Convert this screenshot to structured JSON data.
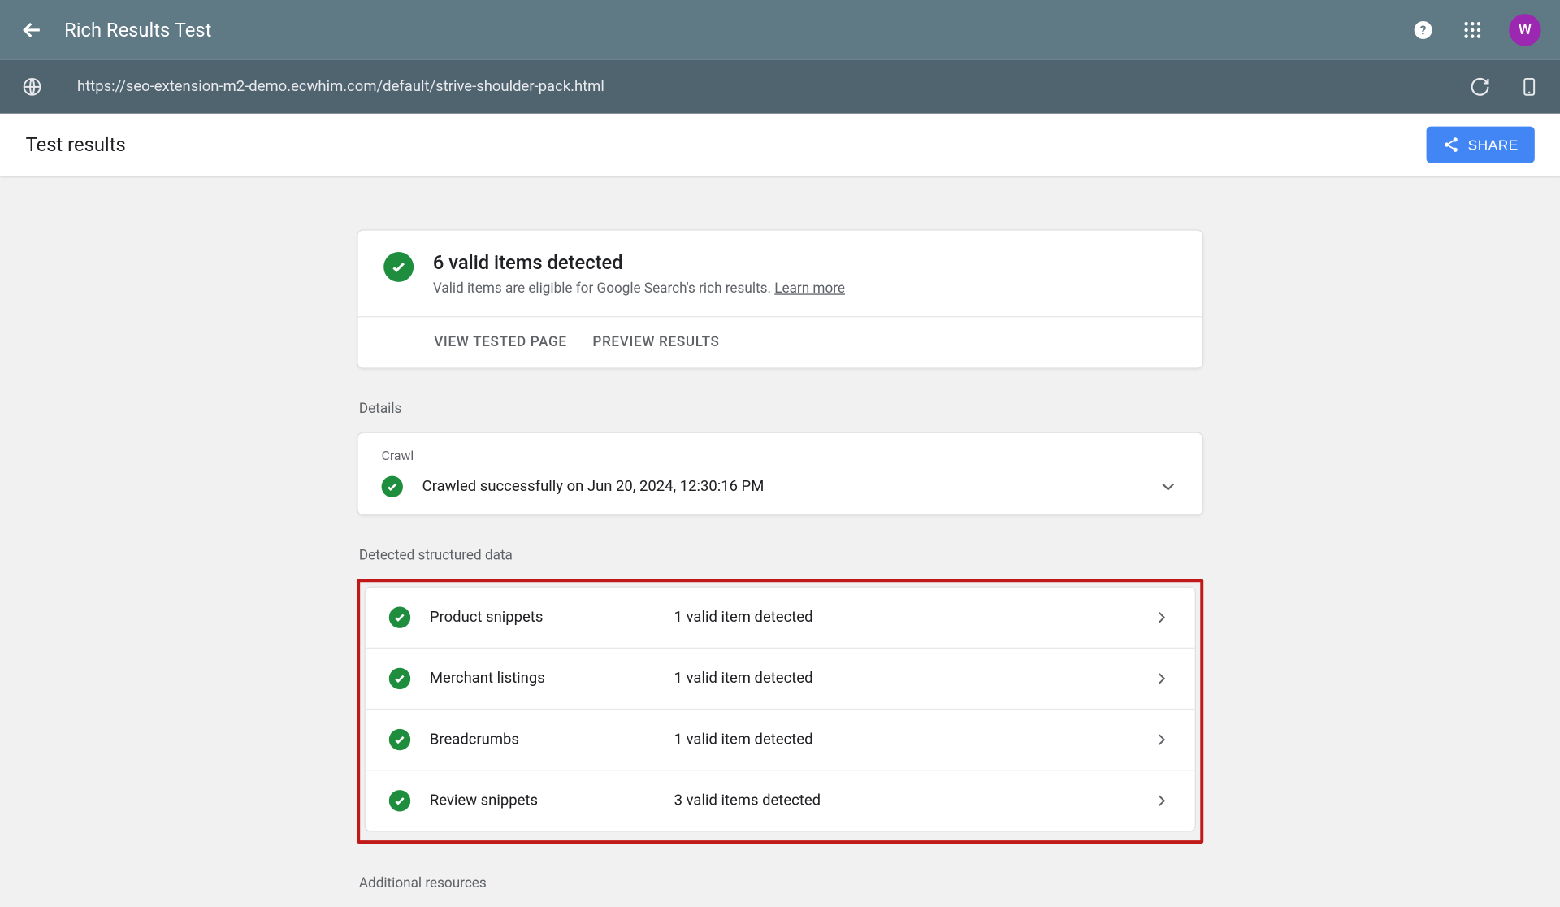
{
  "header": {
    "title": "Rich Results Test",
    "avatar_initial": "W"
  },
  "url_bar": {
    "url": "https://seo-extension-m2-demo.ecwhim.com/default/strive-shoulder-pack.html"
  },
  "subheader": {
    "title": "Test results",
    "share_label": "SHARE"
  },
  "summary": {
    "title": "6 valid items detected",
    "subtitle_prefix": "Valid items are eligible for Google Search's rich results. ",
    "learn_more": "Learn more",
    "view_tested": "VIEW TESTED PAGE",
    "preview_results": "PREVIEW RESULTS"
  },
  "sections": {
    "details_label": "Details",
    "crawl_label": "Crawl",
    "crawl_text": "Crawled successfully on Jun 20, 2024, 12:30:16 PM",
    "structured_label": "Detected structured data",
    "additional_label": "Additional resources"
  },
  "structured_items": [
    {
      "name": "Product snippets",
      "status": "1 valid item detected"
    },
    {
      "name": "Merchant listings",
      "status": "1 valid item detected"
    },
    {
      "name": "Breadcrumbs",
      "status": "1 valid item detected"
    },
    {
      "name": "Review snippets",
      "status": "3 valid items detected"
    }
  ]
}
